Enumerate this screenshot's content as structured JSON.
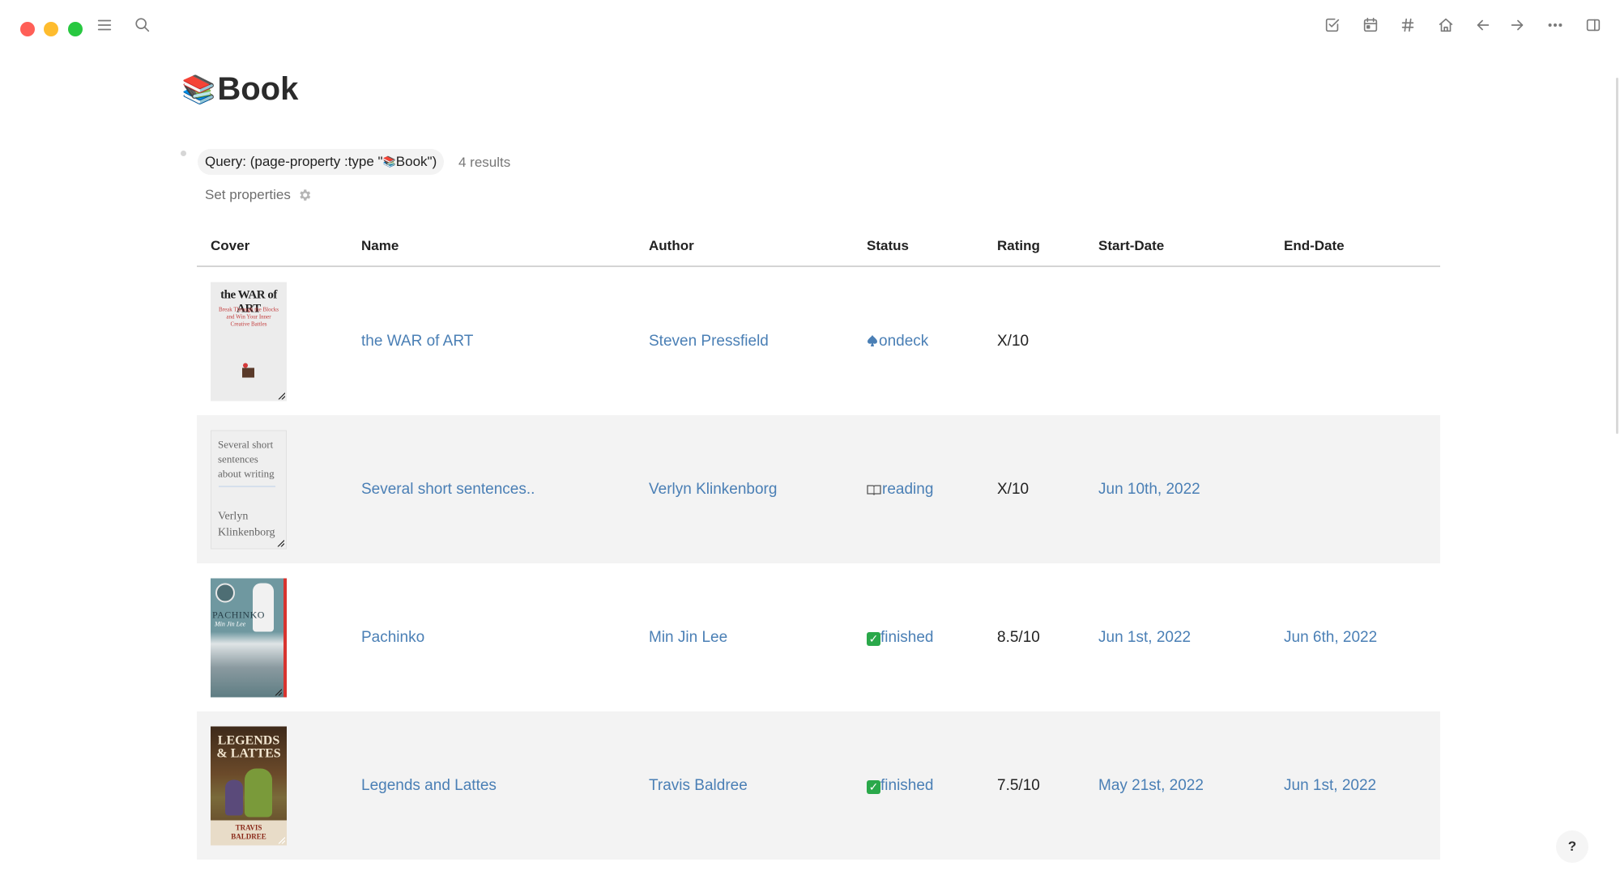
{
  "window": {
    "traffic_lights": [
      "close",
      "minimize",
      "maximize"
    ]
  },
  "toolbar": {
    "left_icons": [
      "menu-icon",
      "search-icon"
    ],
    "right_icons": [
      "todo-check-icon",
      "calendar-icon",
      "hashtag-icon",
      "home-icon",
      "back-arrow-icon",
      "forward-arrow-icon",
      "more-icon",
      "sidebar-toggle-icon"
    ]
  },
  "page": {
    "title_emoji": "📚",
    "title": "Book"
  },
  "query": {
    "label": "Query: (page-property :type \"",
    "emoji": "📚",
    "label_end": "Book\")",
    "results": "4 results",
    "set_properties": "Set properties"
  },
  "table": {
    "columns": [
      "Cover",
      "Name",
      "Author",
      "Status",
      "Rating",
      "Start-Date",
      "End-Date"
    ],
    "rows": [
      {
        "cover": {
          "title": "the WAR of ART",
          "subtitle": "Break Through the Blocks and Win Your Inner Creative Battles",
          "bg": "#ececec",
          "fg": "#222222"
        },
        "name": "the WAR of ART",
        "author": "Steven Pressfield",
        "status_icon": "spade-icon",
        "status": "ondeck",
        "rating": "X/10",
        "start_date": "",
        "end_date": ""
      },
      {
        "cover": {
          "title": "Several short sentences about writing",
          "subtitle": "Verlyn Klinkenborg",
          "bg": "#efefef",
          "fg": "#666666"
        },
        "name": "Several short sentences..",
        "author": "Verlyn Klinkenborg",
        "status_icon": "open-book-icon",
        "status": "reading",
        "rating": "X/10",
        "start_date": "Jun 10th, 2022",
        "end_date": ""
      },
      {
        "cover": {
          "title": "PACHINKO",
          "subtitle": "Min Jin Lee",
          "bg": "#6f98a0",
          "fg": "#ffffff"
        },
        "name": "Pachinko",
        "author": "Min Jin Lee",
        "status_icon": "check-mark-icon",
        "status": "finished",
        "rating": "8.5/10",
        "start_date": "Jun 1st, 2022",
        "end_date": "Jun 6th, 2022"
      },
      {
        "cover": {
          "title": "LEGENDS & LATTES",
          "subtitle": "TRAVIS BALDREE",
          "bg": "#5a3b22",
          "fg": "#f2e6d0"
        },
        "name": "Legends and Lattes",
        "author": "Travis Baldree",
        "status_icon": "check-mark-icon",
        "status": "finished",
        "rating": "7.5/10",
        "start_date": "May 21st, 2022",
        "end_date": "Jun 1st, 2022"
      }
    ]
  },
  "help": {
    "label": "?"
  },
  "colors": {
    "link": "#4a7fb5",
    "alt_row": "#f3f3f3",
    "pill_bg": "#f3f3f3"
  }
}
